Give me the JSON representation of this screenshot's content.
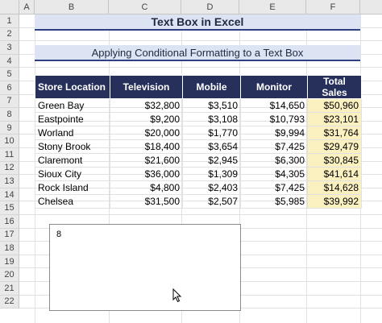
{
  "columns": [
    "A",
    "B",
    "C",
    "D",
    "E",
    "F"
  ],
  "rows": [
    "1",
    "2",
    "3",
    "4",
    "5",
    "6",
    "7",
    "8",
    "9",
    "10",
    "11",
    "12",
    "13",
    "14",
    "15",
    "16",
    "17",
    "18",
    "19",
    "20",
    "21",
    "22"
  ],
  "title": "Text Box in Excel",
  "subtitle": "Applying Conditional Formatting to a Text Box",
  "table": {
    "headers": [
      "Store Location",
      "Television",
      "Mobile",
      "Monitor",
      "Total Sales"
    ],
    "rows": [
      [
        "Green Bay",
        "$32,800",
        "$3,510",
        "$14,650",
        "$50,960"
      ],
      [
        "Eastpointe",
        "$9,200",
        "$3,108",
        "$10,793",
        "$23,101"
      ],
      [
        "Worland",
        "$20,000",
        "$1,770",
        "$9,994",
        "$31,764"
      ],
      [
        "Stony Brook",
        "$18,400",
        "$3,654",
        "$7,425",
        "$29,479"
      ],
      [
        "Claremont",
        "$21,600",
        "$2,945",
        "$6,300",
        "$30,845"
      ],
      [
        "Sioux City",
        "$36,000",
        "$1,309",
        "$4,305",
        "$41,614"
      ],
      [
        "Rock Island",
        "$4,800",
        "$2,403",
        "$7,425",
        "$14,628"
      ],
      [
        "Chelsea",
        "$31,500",
        "$2,507",
        "$5,985",
        "$39,992"
      ]
    ]
  },
  "textbox": {
    "value": "8"
  },
  "colors": {
    "header_bg": "#26305a",
    "total_highlight": "#fbf0c0",
    "title_band": "#dce3f2"
  }
}
